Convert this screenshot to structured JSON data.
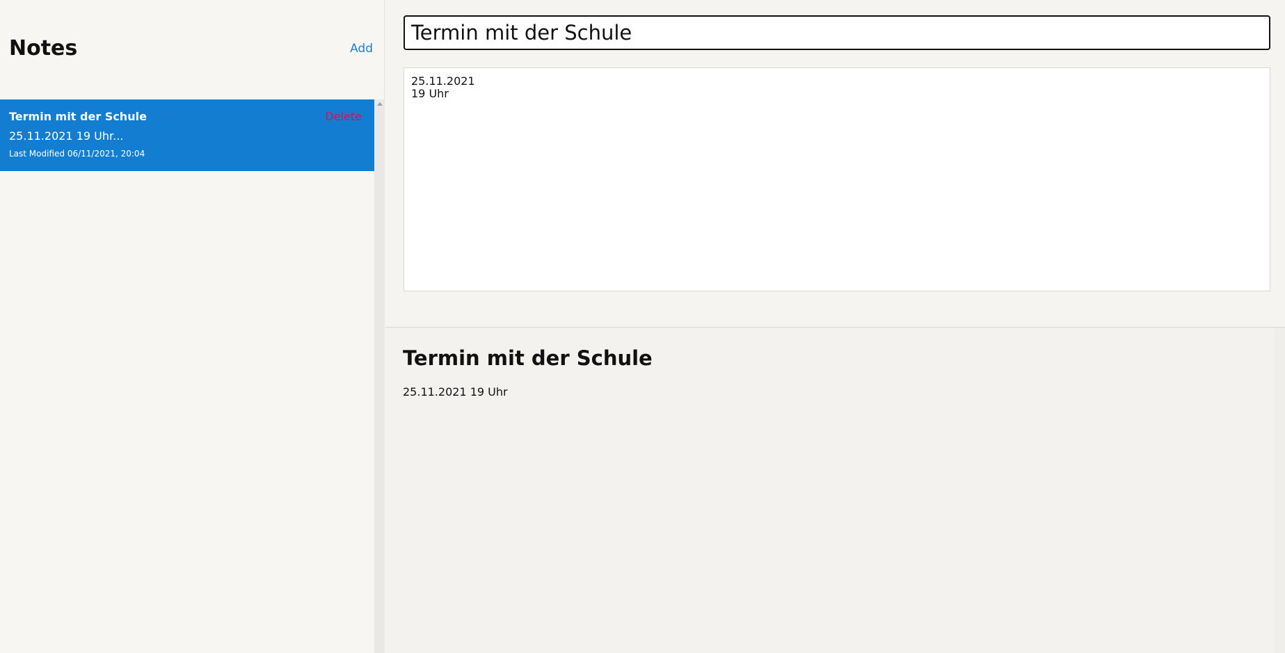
{
  "sidebar": {
    "title": "Notes",
    "add_label": "Add",
    "notes": [
      {
        "title": "Termin mit der Schule",
        "delete_label": "Delete",
        "preview": "25.11.2021 19 Uhr...",
        "modified": "Last Modified 06/11/2021, 20:04"
      }
    ]
  },
  "editor": {
    "title_value": "Termin mit der Schule",
    "body_value": "25.11.2021\n19 Uhr"
  },
  "preview": {
    "title": "Termin mit der Schule",
    "body": "25.11.2021 19 Uhr"
  },
  "colors": {
    "accent": "#127dd1",
    "link": "#1a7fd4",
    "delete": "#d4144f"
  }
}
